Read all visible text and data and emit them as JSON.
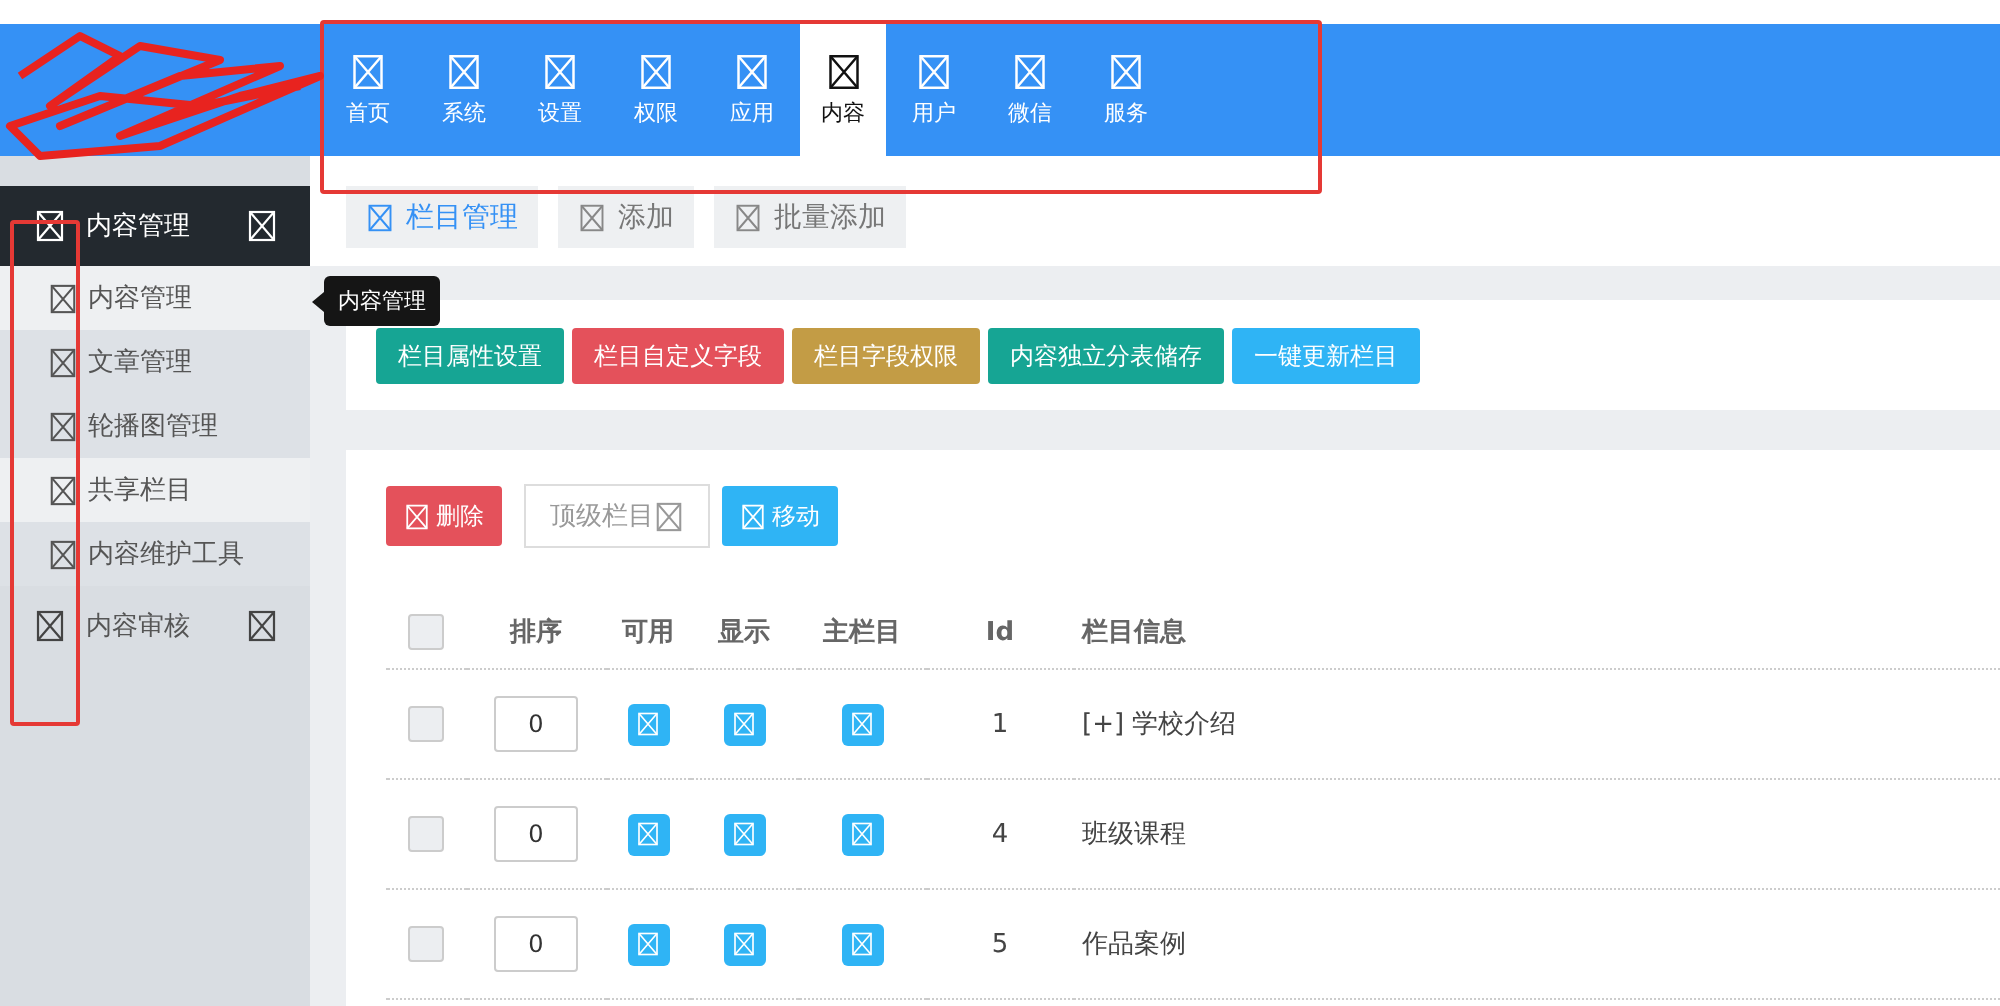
{
  "top_nav": [
    {
      "label": "首页",
      "selected": false
    },
    {
      "label": "系统",
      "selected": false
    },
    {
      "label": "设置",
      "selected": false
    },
    {
      "label": "权限",
      "selected": false
    },
    {
      "label": "应用",
      "selected": false
    },
    {
      "label": "内容",
      "selected": true
    },
    {
      "label": "用户",
      "selected": false
    },
    {
      "label": "微信",
      "selected": false
    },
    {
      "label": "服务",
      "selected": false
    }
  ],
  "sidebar": {
    "groups": [
      {
        "label": "内容管理",
        "expanded": true,
        "children": [
          {
            "label": "内容管理",
            "selected": true
          },
          {
            "label": "文章管理",
            "selected": false
          },
          {
            "label": "轮播图管理",
            "selected": false
          },
          {
            "label": "共享栏目",
            "selected": true
          },
          {
            "label": "内容维护工具",
            "selected": false
          }
        ]
      },
      {
        "label": "内容审核",
        "expanded": false
      }
    ]
  },
  "tooltip": {
    "text": "内容管理"
  },
  "tabs": [
    {
      "label": "栏目管理",
      "selected": true
    },
    {
      "label": "添加",
      "selected": false
    },
    {
      "label": "批量添加",
      "selected": false
    }
  ],
  "action_buttons": [
    {
      "label": "栏目属性设置",
      "color": "#16a594"
    },
    {
      "label": "栏目自定义字段",
      "color": "#e4515b"
    },
    {
      "label": "栏目字段权限",
      "color": "#c39c45"
    },
    {
      "label": "内容独立分表储存",
      "color": "#16a594"
    },
    {
      "label": "一键更新栏目",
      "color": "#2fb4f5"
    }
  ],
  "toolbar": {
    "delete_button": "删除",
    "parent_select": {
      "value": "顶级栏目"
    },
    "move_button": "移动"
  },
  "table": {
    "columns": [
      "排序",
      "可用",
      "显示",
      "主栏目",
      "Id",
      "栏目信息"
    ],
    "header_checkbox": {
      "checked": false
    },
    "rows": [
      {
        "checked": false,
        "sort": "0",
        "id": "1",
        "info": "[+] 学校介绍"
      },
      {
        "checked": false,
        "sort": "0",
        "id": "4",
        "info": "班级课程"
      },
      {
        "checked": false,
        "sort": "0",
        "id": "5",
        "info": "作品案例"
      }
    ]
  }
}
